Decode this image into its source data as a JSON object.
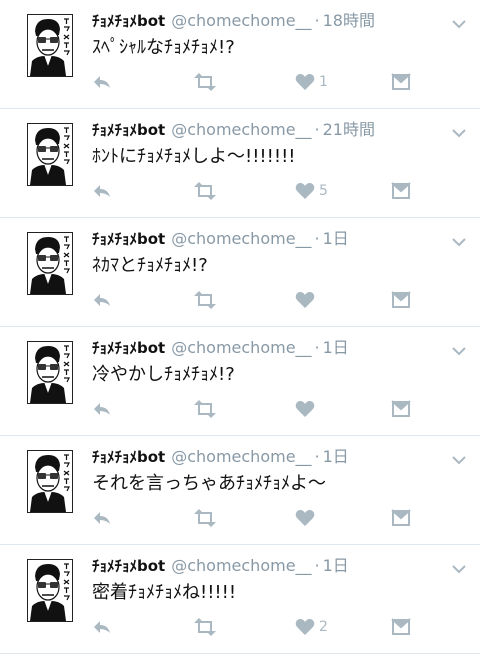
{
  "colors": {
    "icon": "#aab8c2",
    "divider": "#e1e8ed",
    "meta": "#8899a6"
  },
  "icons": {
    "avatar": "avatar-portrait",
    "caret": "chevron-down-icon",
    "reply": "reply-icon",
    "retweet": "retweet-icon",
    "like": "heart-icon",
    "dm": "direct-message-icon"
  },
  "tweets": [
    {
      "name": "ﾁｮﾒﾁｮﾒbot",
      "handle": "@chomechome__",
      "time": "18時間",
      "text": "ｽﾍﾟｼｬﾙなﾁｮﾒﾁｮﾒ!?",
      "likes": "1"
    },
    {
      "name": "ﾁｮﾒﾁｮﾒbot",
      "handle": "@chomechome__",
      "time": "21時間",
      "text": "ﾎﾝﾄにﾁｮﾒﾁｮﾒしよ〜!!!!!!!",
      "likes": "5"
    },
    {
      "name": "ﾁｮﾒﾁｮﾒbot",
      "handle": "@chomechome__",
      "time": "1日",
      "text": "ﾈｶﾏとﾁｮﾒﾁｮﾒ!?",
      "likes": ""
    },
    {
      "name": "ﾁｮﾒﾁｮﾒbot",
      "handle": "@chomechome__",
      "time": "1日",
      "text": "冷やかしﾁｮﾒﾁｮﾒ!?",
      "likes": ""
    },
    {
      "name": "ﾁｮﾒﾁｮﾒbot",
      "handle": "@chomechome__",
      "time": "1日",
      "text": "それを言っちゃあﾁｮﾒﾁｮﾒよ〜",
      "likes": ""
    },
    {
      "name": "ﾁｮﾒﾁｮﾒbot",
      "handle": "@chomechome__",
      "time": "1日",
      "text": "密着ﾁｮﾒﾁｮﾒね!!!!!",
      "likes": "2"
    }
  ]
}
